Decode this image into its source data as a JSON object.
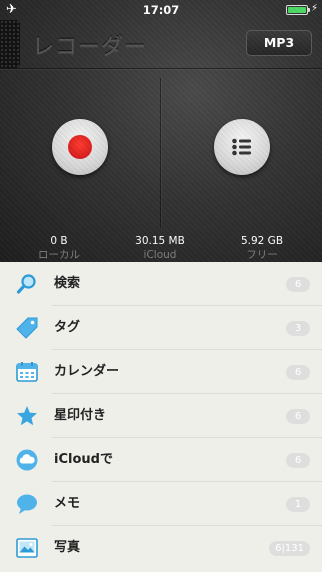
{
  "status_bar": {
    "time": "17:07",
    "airplane_icon": "airplane-icon",
    "battery_color": "#4cd964"
  },
  "header": {
    "title": "レコーダー",
    "format_button": "MP3"
  },
  "recorder": {
    "record_icon": "record-icon",
    "record_color": "#d81e1e",
    "list_icon": "list-icon"
  },
  "storage": {
    "local": {
      "value": "0 B",
      "label": "ローカル"
    },
    "icloud": {
      "value": "30.15 MB",
      "label": "iCloud"
    },
    "free": {
      "value": "5.92 GB",
      "label": "フリー"
    }
  },
  "menu": {
    "accent_color": "#3aa6e0",
    "items": [
      {
        "label": "検索",
        "count": "6",
        "icon": "search-icon"
      },
      {
        "label": "タグ",
        "count": "3",
        "icon": "tag-icon"
      },
      {
        "label": "カレンダー",
        "count": "6",
        "icon": "calendar-icon"
      },
      {
        "label": "星印付き",
        "count": "6",
        "icon": "star-icon"
      },
      {
        "label": "iCloudで",
        "count": "6",
        "icon": "cloud-icon"
      },
      {
        "label": "メモ",
        "count": "1",
        "icon": "speech-bubble-icon"
      },
      {
        "label": "写真",
        "count": "6|131",
        "icon": "photo-icon"
      }
    ]
  }
}
